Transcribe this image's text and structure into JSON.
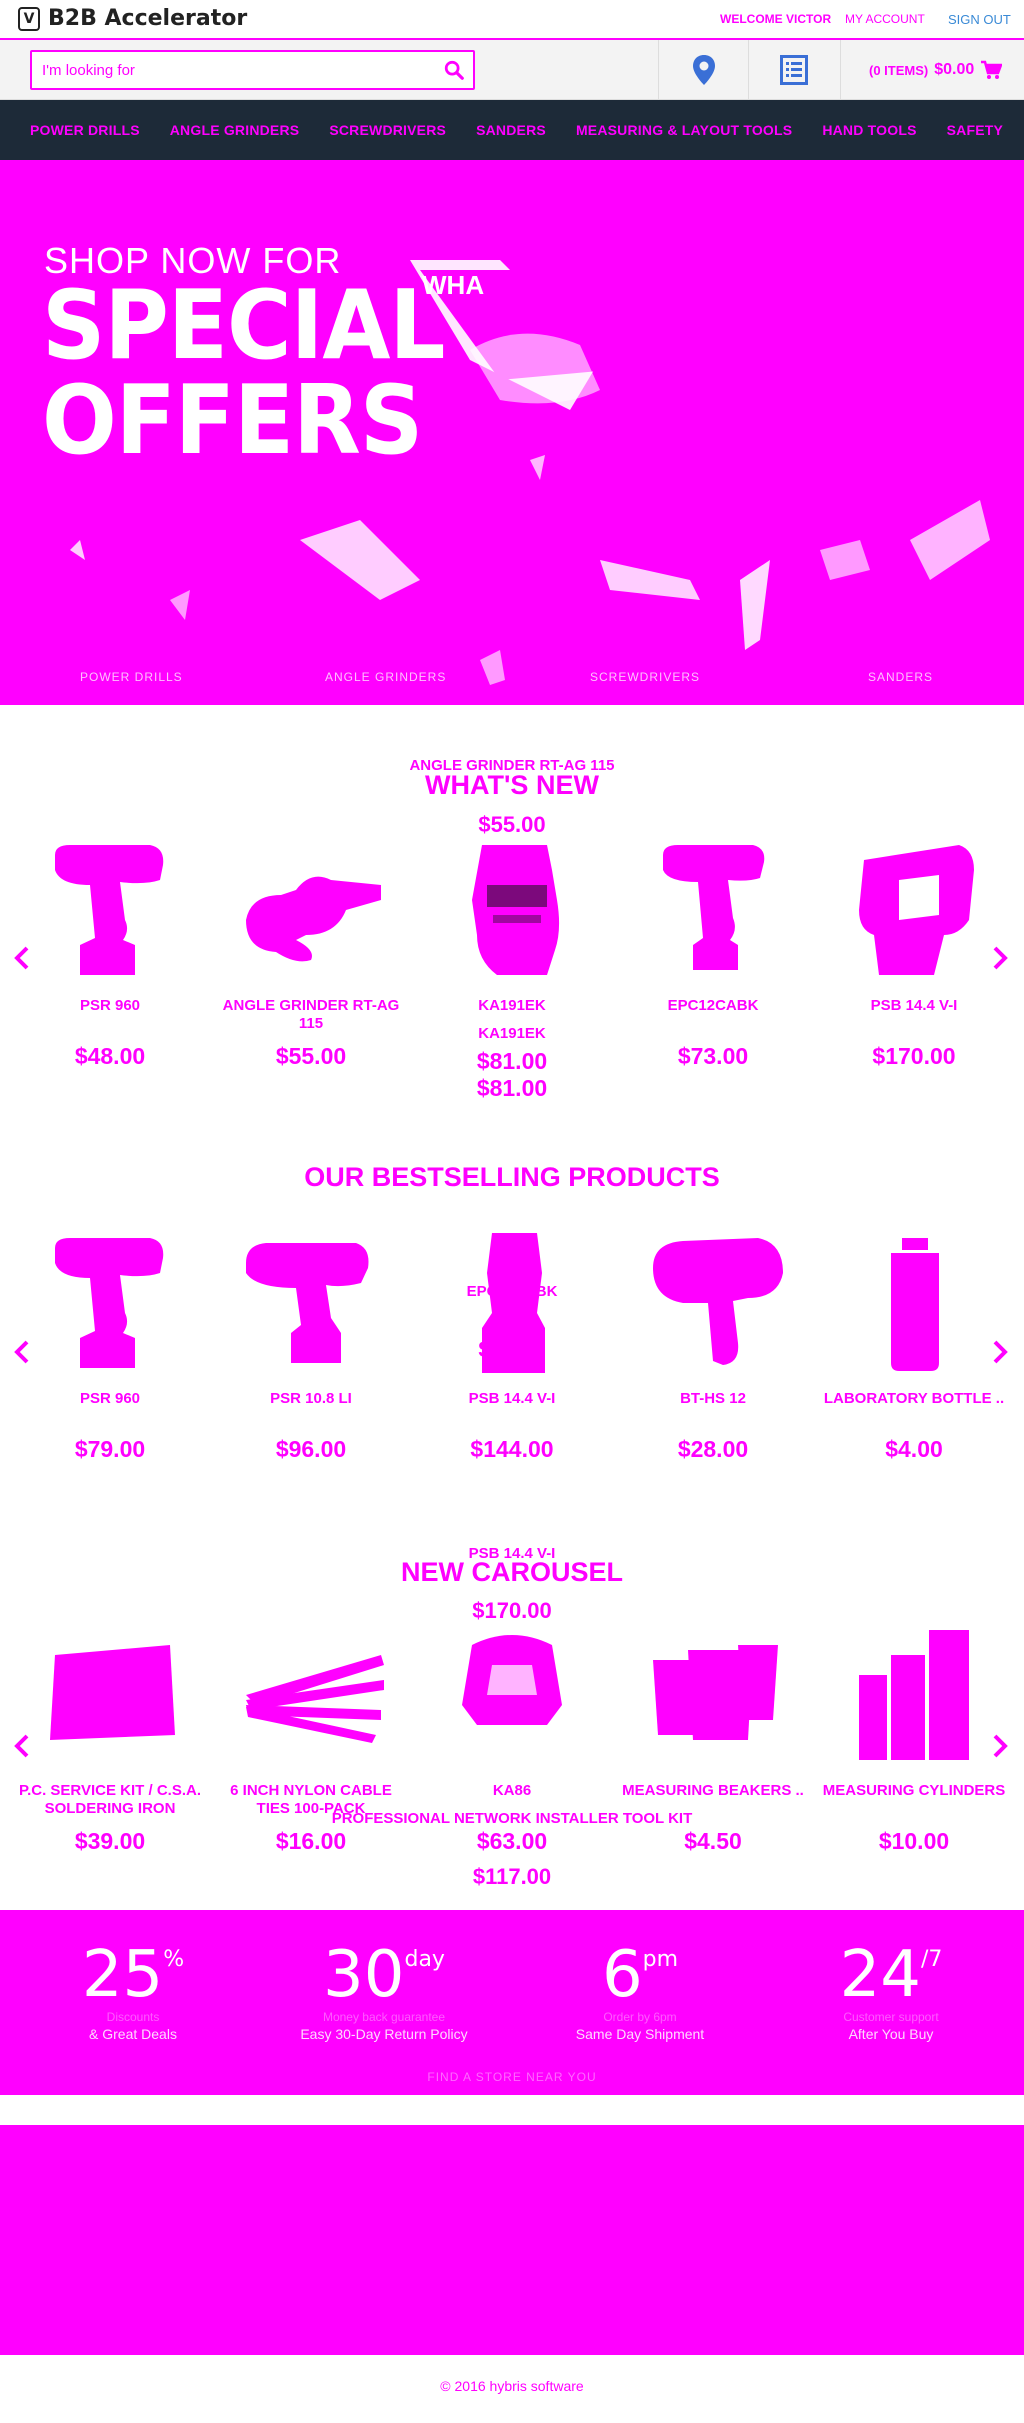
{
  "header": {
    "brand": "B2B Accelerator",
    "logo_glyph": "(v)",
    "welcome": "WELCOME VICTOR",
    "my_account": "MY ACCOUNT",
    "sign_out": "SIGN OUT",
    "search_placeholder": "I'm looking for",
    "cart_items": "(0 ITEMS)",
    "cart_total": "$0.00"
  },
  "nav": [
    "POWER DRILLS",
    "ANGLE GRINDERS",
    "SCREWDRIVERS",
    "SANDERS",
    "MEASURING & LAYOUT TOOLS",
    "HAND TOOLS",
    "SAFETY"
  ],
  "hero": {
    "subtitle": "SHOP NOW FOR",
    "title_line1": "SPECIAL",
    "title_line2": "OFFERS",
    "overlay_text": "WHA",
    "category_labels": [
      "POWER DRILLS",
      "ANGLE GRINDERS",
      "SCREWDRIVERS",
      "SANDERS"
    ]
  },
  "whats_new": {
    "title": "WHAT'S NEW",
    "stray_name": "ANGLE GRINDER RT-AG 115",
    "stray_price": "$55.00",
    "products": [
      {
        "name": "PSR 960",
        "price": "$48.00",
        "icon": "drill"
      },
      {
        "name": "ANGLE GRINDER RT-AG 115",
        "price": "$55.00",
        "icon": "grinder"
      },
      {
        "name": "KA191EK",
        "price": "$81.00",
        "icon": "tool-kit"
      },
      {
        "name": "EPC12CABK",
        "price": "$73.00",
        "icon": "drill"
      },
      {
        "name": "PSB 14.4 V-I",
        "price": "$170.00",
        "icon": "hammer-drill"
      }
    ],
    "dup_name": "KA191EK",
    "dup_price": "$81.00"
  },
  "bestselling": {
    "title": "OUR BESTSELLING PRODUCTS",
    "stray_name": "EPC12CABK",
    "stray_price": "$73.00",
    "products": [
      {
        "name": "PSR 960",
        "price": "$79.00",
        "icon": "drill"
      },
      {
        "name": "PSR 10.8 LI",
        "price": "$96.00",
        "icon": "drill"
      },
      {
        "name": "PSB 14.4 V-I",
        "price": "$144.00",
        "icon": "drill"
      },
      {
        "name": "BT-HS 12",
        "price": "$28.00",
        "icon": "heat-gun"
      },
      {
        "name": "LABORATORY BOTTLE ..",
        "price": "$4.00",
        "icon": "bottle"
      }
    ]
  },
  "new_carousel": {
    "title": "NEW CAROUSEL",
    "stray_name": "PSB 14.4 V-I",
    "stray_price": "$170.00",
    "products": [
      {
        "name": "P.C. SERVICE KIT / C.S.A. SOLDERING IRON",
        "price": "$39.00",
        "icon": "case"
      },
      {
        "name": "6 INCH NYLON CABLE TIES 100-PACK",
        "price": "$16.00",
        "icon": "cable-ties"
      },
      {
        "name": "KA86",
        "price": "$63.00",
        "icon": "tool-kit"
      },
      {
        "name": "MEASURING BEAKERS ..",
        "price": "$4.50",
        "icon": "beakers"
      },
      {
        "name": "MEASURING CYLINDERS",
        "price": "$10.00",
        "icon": "cylinders"
      }
    ],
    "overlay_name": "PROFESSIONAL NETWORK INSTALLER TOOL KIT",
    "overlay_price": "$117.00"
  },
  "features": [
    {
      "big": "25",
      "sup": "%",
      "tiny": "Discounts",
      "small": "& Great Deals"
    },
    {
      "big": "30",
      "sup": "day",
      "tiny": "Money back guarantee",
      "small": "Easy 30-Day Return Policy"
    },
    {
      "big": "6",
      "sup": "pm",
      "tiny": "Order by 6pm",
      "small": "Same Day Shipment"
    },
    {
      "big": "24",
      "sup": "/7",
      "tiny": "Customer support",
      "small": "After You Buy"
    }
  ],
  "features_footer": "FIND A STORE NEAR YOU",
  "copyright": "© 2016 hybris software",
  "colors": {
    "accent": "#ff00ff",
    "nav_bg": "#1d2a38",
    "link": "#3a8ad6"
  }
}
